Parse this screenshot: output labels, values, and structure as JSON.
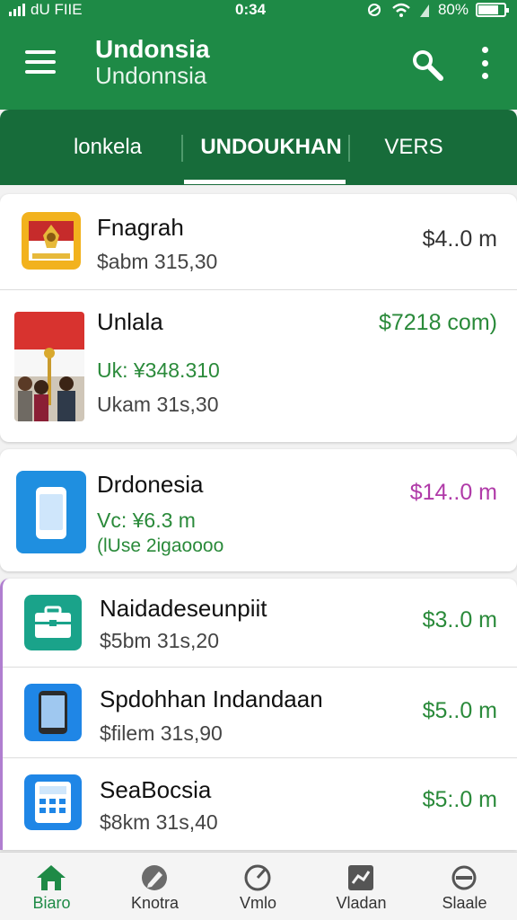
{
  "status_bar": {
    "carrier": "dU FIIE",
    "time": "0:34",
    "battery": "80%",
    "battery_level": 0.8
  },
  "app_bar": {
    "title": "Undonsia",
    "subtitle": "Undonnsia",
    "menu_icon": "hamburger-menu-icon",
    "search_icon": "search-icon",
    "more_icon": "more-vertical-icon"
  },
  "tabs": [
    {
      "label": "lonkela",
      "active": false
    },
    {
      "label": "UNDOUKHAN",
      "active": true
    },
    {
      "label": "VERS",
      "active": false
    }
  ],
  "items": [
    {
      "name": "Fnagrah",
      "line1": "$abm 315,30",
      "line2": "",
      "price": "$4..0 m",
      "price_color": "#333333",
      "thumb": "flag-emblem-thumbnail"
    },
    {
      "name": "Unlala",
      "line1": "Uk: ¥348.310",
      "line2": "Ukam 31s,30",
      "price": "$7218 com)",
      "price_color": "#2a8a3a",
      "thumb": "people-flag-photo-thumbnail"
    },
    {
      "name": "Drdonesia",
      "line1": "Vc: ¥6.3 m",
      "line2": "(lUse 2igaoooo",
      "price": "$14..0 m",
      "price_color": "#b03aa8",
      "thumb": "smartphone-app-thumbnail"
    },
    {
      "name": "Naidadeseunpiit",
      "line1": "$5bm 31s,20",
      "line2": "",
      "price": "$3..0 m",
      "price_color": "#2a8a3a",
      "thumb": "briefcase-app-thumbnail"
    },
    {
      "name": "Spdohhan Indandaan",
      "line1": "$filem 31s,90",
      "line2": "",
      "price": "$5..0 m",
      "price_color": "#2a8a3a",
      "thumb": "phone-app-thumbnail"
    },
    {
      "name": "SeaBocsia",
      "line1": "$8km 31s,40",
      "line2": "",
      "price": "$5:.0 m",
      "price_color": "#2a8a3a",
      "thumb": "calculator-app-thumbnail"
    }
  ],
  "bottom_nav": [
    {
      "label": "Biaro",
      "icon": "home-icon",
      "active": true
    },
    {
      "label": "Knotra",
      "icon": "pencil-circle-icon",
      "active": false
    },
    {
      "label": "Vmlo",
      "icon": "gauge-icon",
      "active": false
    },
    {
      "label": "Vladan",
      "icon": "chart-box-icon",
      "active": false
    },
    {
      "label": "Slaale",
      "icon": "minus-circle-icon",
      "active": false
    }
  ],
  "colors": {
    "primary": "#1e8a46",
    "primary_dark": "#176c3a",
    "accent_purple": "#b03aa8"
  }
}
